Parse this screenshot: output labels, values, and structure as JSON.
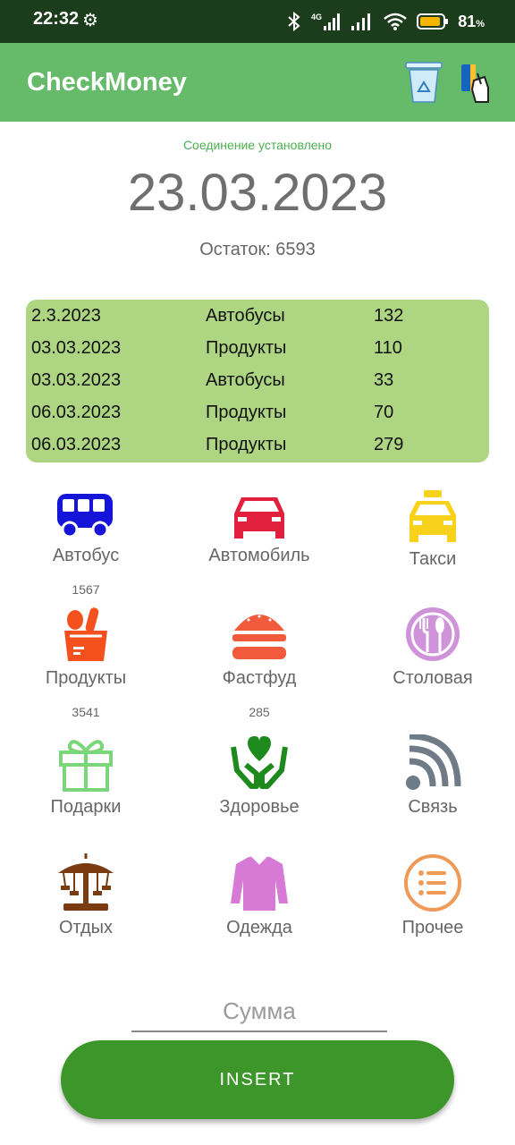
{
  "status_bar": {
    "time": "22:32",
    "network": "4G",
    "battery": "81"
  },
  "app_bar": {
    "title": "CheckMoney"
  },
  "connection_status": "Соединение установлено",
  "current_date": "23.03.2023",
  "balance": "Остаток: 6593",
  "transactions": [
    {
      "date": "2.3.2023",
      "category": "Автобусы",
      "amount": "132"
    },
    {
      "date": "03.03.2023",
      "category": "Продукты",
      "amount": "110"
    },
    {
      "date": "03.03.2023",
      "category": "Автобусы",
      "amount": "33"
    },
    {
      "date": "06.03.2023",
      "category": "Продукты",
      "amount": "70"
    },
    {
      "date": "06.03.2023",
      "category": "Продукты",
      "amount": "279"
    }
  ],
  "categories": [
    {
      "label": "Автобус",
      "amount": "1567",
      "icon": "bus-icon",
      "color": "#1515d9"
    },
    {
      "label": "Автомобиль",
      "amount": "",
      "icon": "car-icon",
      "color": "#e0203c"
    },
    {
      "label": "Такси",
      "amount": "",
      "icon": "taxi-icon",
      "color": "#f7d11a"
    },
    {
      "label": "Продукты",
      "amount": "3541",
      "icon": "groceries-icon",
      "color": "#f4511e"
    },
    {
      "label": "Фастфуд",
      "amount": "285",
      "icon": "burger-icon",
      "color": "#f15a3a"
    },
    {
      "label": "Столовая",
      "amount": "",
      "icon": "dining-icon",
      "color": "#ce93d8"
    },
    {
      "label": "Подарки",
      "amount": "",
      "icon": "gift-icon",
      "color": "#7bd67b"
    },
    {
      "label": "Здоровье",
      "amount": "",
      "icon": "health-icon",
      "color": "#1e8a1e"
    },
    {
      "label": "Связь",
      "amount": "",
      "icon": "signal-icon",
      "color": "#6f7b87"
    },
    {
      "label": "Отдых",
      "amount": "",
      "icon": "carousel-icon",
      "color": "#7a3b10"
    },
    {
      "label": "Одежда",
      "amount": "",
      "icon": "shirt-icon",
      "color": "#d67ad6"
    },
    {
      "label": "Прочее",
      "amount": "",
      "icon": "list-icon",
      "color": "#f09a58"
    }
  ],
  "sum_field": {
    "placeholder": "Сумма"
  },
  "insert_button": {
    "label": "INSERT"
  }
}
